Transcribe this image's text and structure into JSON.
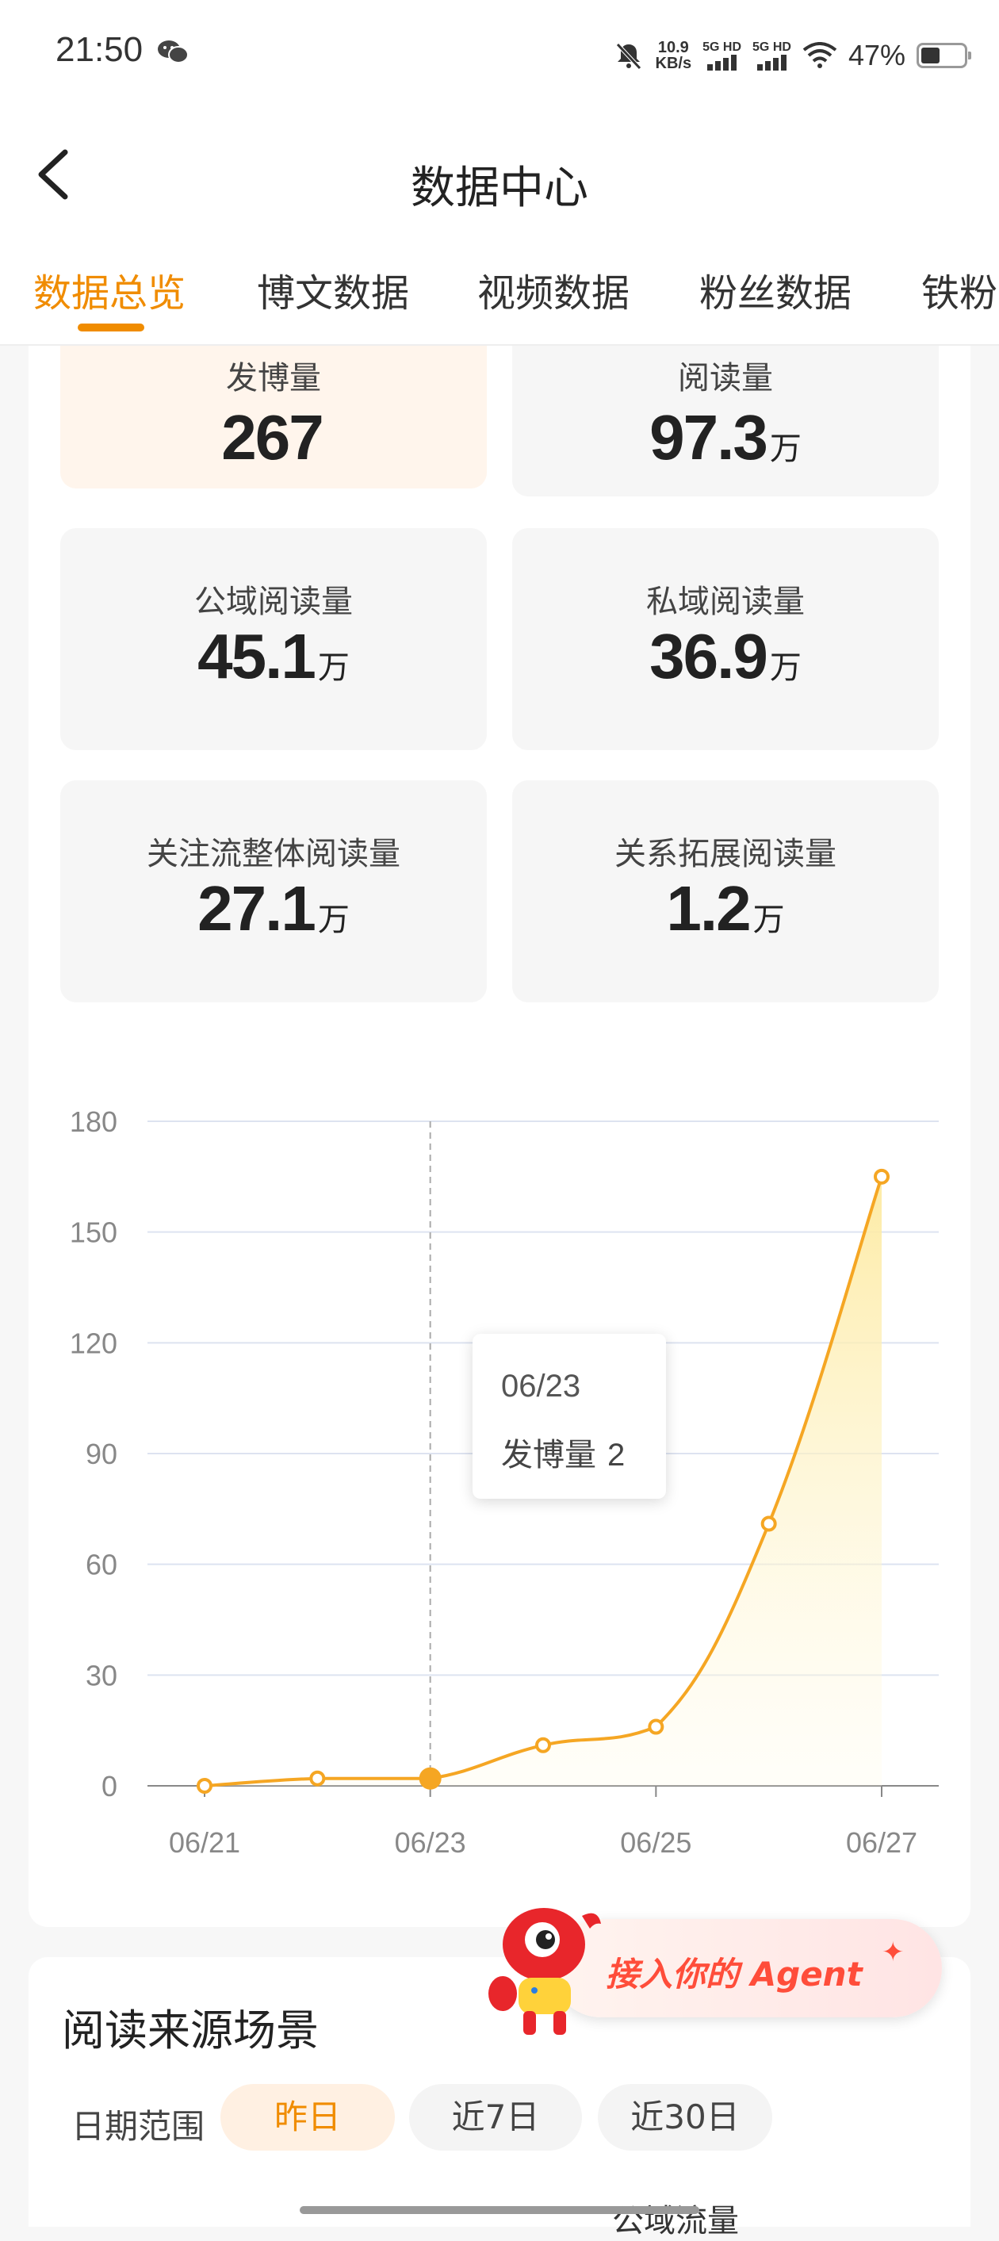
{
  "status_bar": {
    "time": "21:50",
    "net_speed_value": "10.9",
    "net_speed_unit": "KB/s",
    "sim1": "5G HD",
    "sim2": "5G HD",
    "battery": "47%",
    "icons": [
      "wechat-icon",
      "mute-bell-icon",
      "signal-icon",
      "wifi-icon",
      "battery-icon"
    ]
  },
  "nav": {
    "title": "数据中心",
    "back_icon": "chevron-left-icon"
  },
  "tabs": [
    {
      "label": "数据总览",
      "active": true
    },
    {
      "label": "博文数据",
      "active": false
    },
    {
      "label": "视频数据",
      "active": false
    },
    {
      "label": "粉丝数据",
      "active": false
    },
    {
      "label": "铁粉",
      "active": false
    }
  ],
  "metrics": [
    {
      "label": "发博量",
      "value": "267",
      "unit": "",
      "selected": true
    },
    {
      "label": "阅读量",
      "value": "97.3",
      "unit": "万",
      "selected": false
    },
    {
      "label": "公域阅读量",
      "value": "45.1",
      "unit": "万",
      "selected": false
    },
    {
      "label": "私域阅读量",
      "value": "36.9",
      "unit": "万",
      "selected": false
    },
    {
      "label": "关注流整体阅读量",
      "value": "27.1",
      "unit": "万",
      "selected": false
    },
    {
      "label": "关系拓展阅读量",
      "value": "1.2",
      "unit": "万",
      "selected": false
    }
  ],
  "chart_data": {
    "type": "area",
    "x": [
      "06/21",
      "06/22",
      "06/23",
      "06/24",
      "06/25",
      "06/26",
      "06/27"
    ],
    "x_tick_labels": [
      "06/21",
      "06/23",
      "06/25",
      "06/27"
    ],
    "series": [
      {
        "name": "发博量",
        "values": [
          0,
          2,
          2,
          11,
          16,
          71,
          165
        ]
      }
    ],
    "y_ticks": [
      0,
      30,
      60,
      90,
      120,
      150,
      180
    ],
    "ylim": [
      0,
      180
    ],
    "grid": true,
    "colors": {
      "line": "#f5a623",
      "area_top": "#fdeaa0",
      "grid": "#dde3f0",
      "axis": "#888888"
    },
    "tooltip": {
      "date": "06/23",
      "label": "发博量",
      "value": "2"
    }
  },
  "agent_banner": {
    "label": "接入你的 Agent",
    "icon": "mascot-icon"
  },
  "source_section": {
    "title": "阅读来源场景",
    "range_label": "日期范围",
    "options": [
      {
        "label": "昨日",
        "active": true
      },
      {
        "label": "近7日",
        "active": false
      },
      {
        "label": "近30日",
        "active": false
      }
    ],
    "footer_partial": "公域流量"
  },
  "accent_color": "#f08c00"
}
